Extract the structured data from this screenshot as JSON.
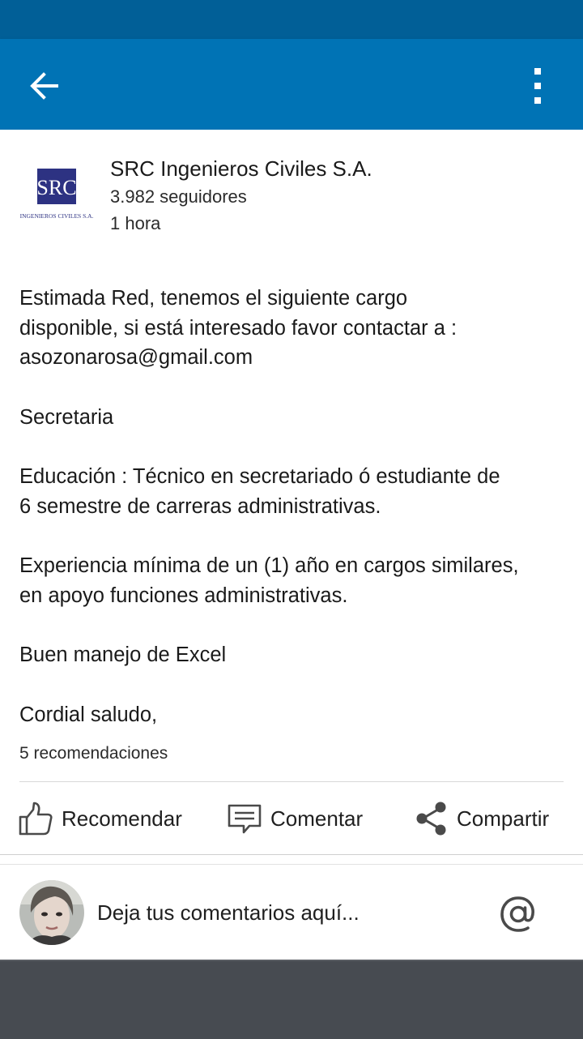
{
  "header": {
    "back_icon": "arrow-left-icon",
    "more_icon": "more-vertical-icon",
    "accent_color": "#0073b5"
  },
  "post": {
    "company_name": "SRC Ingenieros Civiles S.A.",
    "followers": "3.982 seguidores",
    "time": "1 hora",
    "logo": {
      "mark": "SRC",
      "caption": "INGENIEROS CIVILES S.A."
    },
    "body": {
      "p1_l1": "Estimada Red, tenemos el siguiente cargo",
      "p1_l2": "disponible, si está interesado favor contactar a :",
      "p1_l3": "asozonarosa@gmail.com",
      "p2": "Secretaria",
      "p3_l1": "Educación :  Técnico en secretariado ó estudiante  de",
      "p3_l2": "6 semestre de carreras administrativas.",
      "p4_l1": "Experiencia mínima de un (1) año en cargos similares,",
      "p4_l2": "en  apoyo  funciones administrativas.",
      "p5": "Buen manejo de Excel",
      "p6": "Cordial saludo,"
    },
    "likes": "5 recomendaciones"
  },
  "actions": {
    "recommend": {
      "label": "Recomendar",
      "icon": "thumbs-up-icon"
    },
    "comment": {
      "label": "Comentar",
      "icon": "comment-icon"
    },
    "share": {
      "label": "Compartir",
      "icon": "share-icon"
    }
  },
  "comment_bar": {
    "placeholder": "Deja tus comentarios aquí...",
    "mention_icon": "at-sign-icon"
  }
}
